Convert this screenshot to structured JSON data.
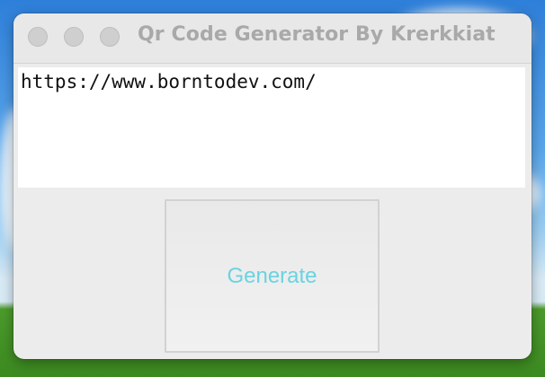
{
  "window": {
    "title": "Qr Code Generator By Krerkkiat"
  },
  "url_input": {
    "value": "https://www.borntodev.com/"
  },
  "generate_button": {
    "label": "Generate"
  },
  "colors": {
    "button_text": "#6ad3e0",
    "title_text": "#a9a9a9",
    "window_bg": "#ececec"
  }
}
